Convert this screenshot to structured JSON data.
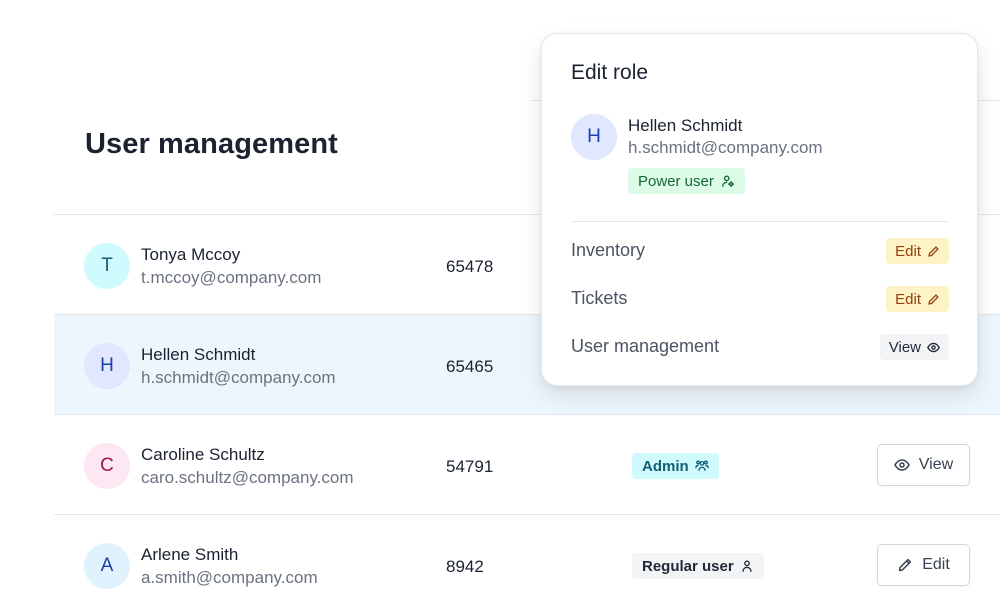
{
  "page": {
    "title": "User management"
  },
  "users": [
    {
      "initial": "T",
      "name": "Tonya Mccoy",
      "email": "t.mccoy@company.com",
      "id": "65478",
      "avatar_bg": "#cffafe",
      "avatar_fg": "#155e75"
    },
    {
      "initial": "H",
      "name": "Hellen Schmidt",
      "email": "h.schmidt@company.com",
      "id": "65465",
      "avatar_bg": "#e0e7ff",
      "avatar_fg": "#1e40af"
    },
    {
      "initial": "C",
      "name": "Caroline Schultz",
      "email": "caro.schultz@company.com",
      "id": "54791",
      "avatar_bg": "#fce7f3",
      "avatar_fg": "#9d174d",
      "role": {
        "label": "Admin",
        "icon": "users-group-icon",
        "bg": "#cffafe",
        "fg": "#155e75"
      },
      "action": {
        "label": "View",
        "icon": "eye-icon"
      }
    },
    {
      "initial": "A",
      "name": "Arlene Smith",
      "email": "a.smith@company.com",
      "id": "8942",
      "avatar_bg": "#e0f2fe",
      "avatar_fg": "#1e40af",
      "role": {
        "label": "Regular user",
        "icon": "user-icon",
        "bg": "#f3f4f6",
        "fg": "#1f2937"
      },
      "action": {
        "label": "Edit",
        "icon": "pencil-icon"
      }
    }
  ],
  "popover": {
    "title": "Edit role",
    "user": {
      "initial": "H",
      "name": "Hellen Schmidt",
      "email": "h.schmidt@company.com"
    },
    "role_badge": {
      "label": "Power user",
      "icon": "user-settings-icon"
    },
    "permissions": [
      {
        "label": "Inventory",
        "badge": "Edit",
        "icon": "pencil-icon",
        "kind": "edit"
      },
      {
        "label": "Tickets",
        "badge": "Edit",
        "icon": "pencil-icon",
        "kind": "edit"
      },
      {
        "label": "User management",
        "badge": "View",
        "icon": "eye-icon",
        "kind": "view"
      }
    ]
  },
  "colors": {
    "selected_row": "#eef6fd",
    "power_user_bg": "#dcfce7",
    "edit_badge_bg": "#fef3c7"
  }
}
